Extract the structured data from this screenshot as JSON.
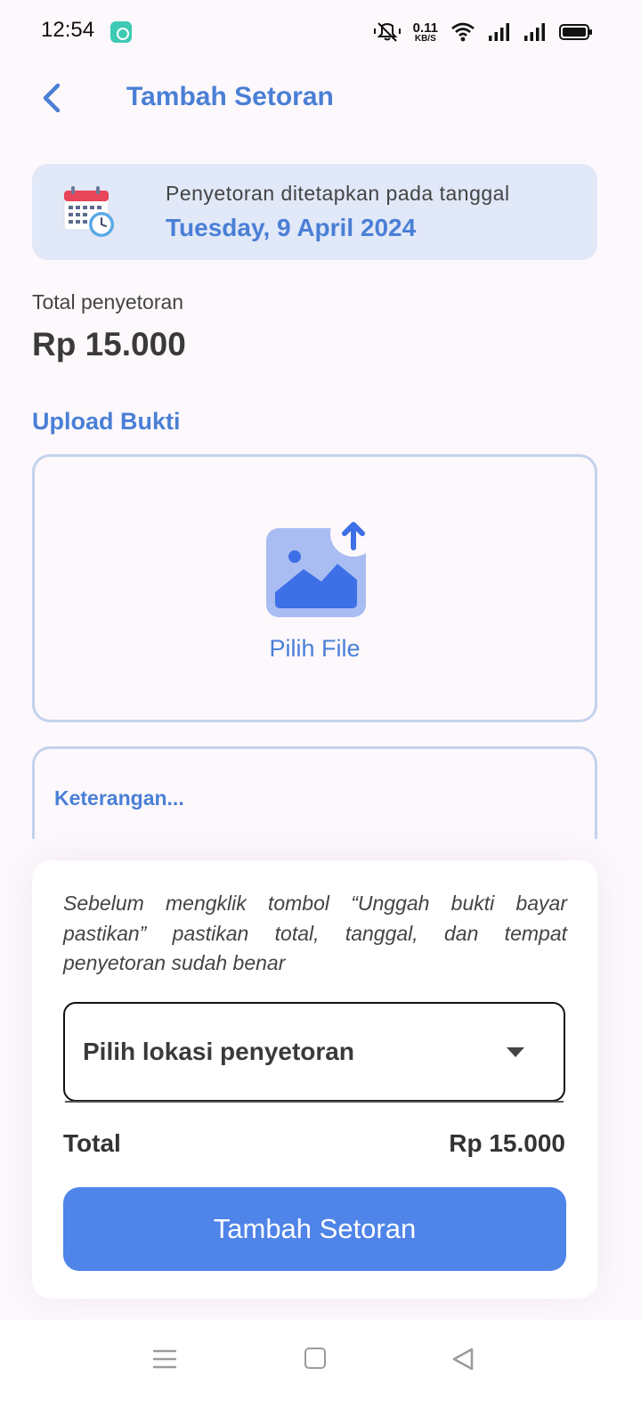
{
  "status_bar": {
    "time": "12:54",
    "net_speed_value": "0.11",
    "net_speed_unit": "KB/S",
    "icons": [
      "app-notification-icon",
      "mute-icon",
      "wifi-icon",
      "signal-icon",
      "signal-icon",
      "battery-icon"
    ]
  },
  "header": {
    "title": "Tambah Setoran",
    "back_icon": "chevron-left-icon"
  },
  "date_banner": {
    "label": "Penyetoran ditetapkan pada tanggal",
    "date": "Tuesday, 9 April 2024",
    "icon": "calendar-clock-icon"
  },
  "summary": {
    "total_label": "Total penyetoran",
    "total_value": "Rp 15.000"
  },
  "upload": {
    "heading": "Upload Bukti",
    "button_label": "Pilih File",
    "icon": "image-upload-icon"
  },
  "note": {
    "placeholder": "Keterangan..."
  },
  "bottom_sheet": {
    "warning": "Sebelum mengklik tombol “Unggah bukti bayar pastikan” pastikan total, tanggal, dan tempat penyetoran sudah benar",
    "location_placeholder": "Pilih lokasi penyetoran",
    "total_label": "Total",
    "total_value": "Rp 15.000",
    "submit_label": "Tambah Setoran"
  },
  "nav_bar": {
    "icons": [
      "menu-icon",
      "home-icon",
      "back-icon"
    ]
  },
  "colors": {
    "accent": "#4a7fd6",
    "button": "#4f84e8",
    "banner": "#e1e8f8",
    "border": "#c4d2ec"
  }
}
